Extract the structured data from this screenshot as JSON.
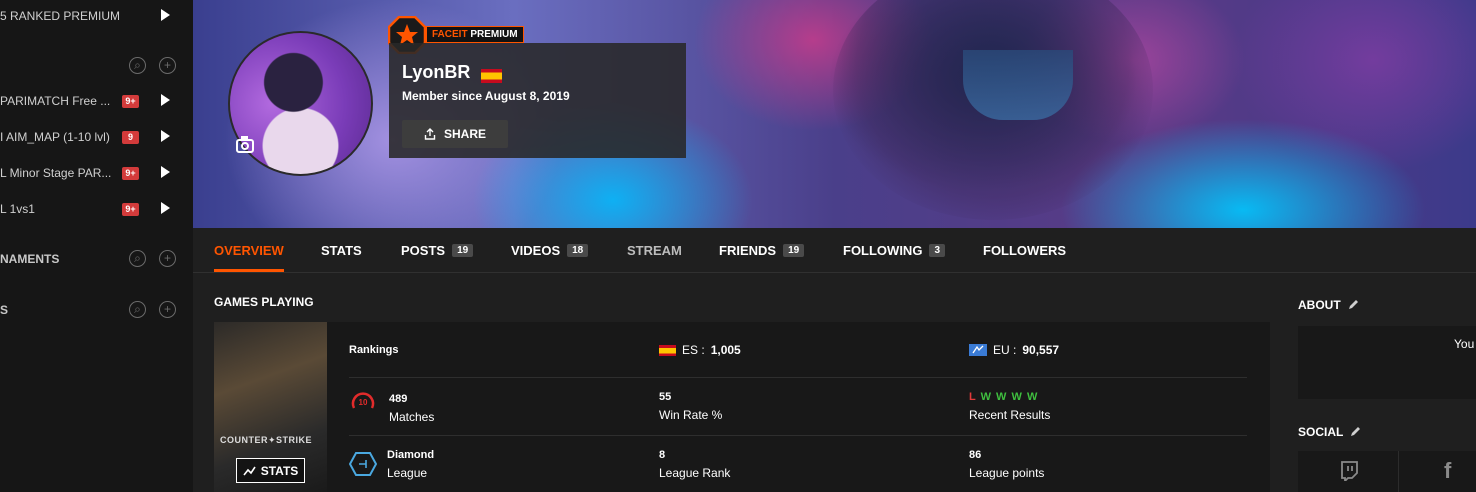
{
  "sidebar": {
    "rows": [
      {
        "label": "5 RANKED PREMIUM",
        "badge": "",
        "play": true
      },
      {
        "label": "PARIMATCH Free ...",
        "badge": "9+",
        "play": true
      },
      {
        "label": "I AIM_MAP (1-10 lvl)",
        "badge": "9",
        "play": true
      },
      {
        "label": "L Minor Stage PAR...",
        "badge": "9+",
        "play": true
      },
      {
        "label": "L 1vs1",
        "badge": "9+",
        "play": true
      }
    ],
    "headers": [
      {
        "label": ""
      },
      {
        "label": "NAMENTS"
      },
      {
        "label": "S"
      }
    ]
  },
  "profile": {
    "premium_label_a": "FACEIT",
    "premium_label_b": "PREMIUM",
    "nickname": "LyonBR",
    "member_since": "Member since August 8, 2019",
    "share_label": "SHARE"
  },
  "tabs": [
    {
      "label": "OVERVIEW",
      "count": ""
    },
    {
      "label": "STATS",
      "count": ""
    },
    {
      "label": "POSTS",
      "count": "19"
    },
    {
      "label": "VIDEOS",
      "count": "18"
    },
    {
      "label": "STREAM",
      "count": ""
    },
    {
      "label": "FRIENDS",
      "count": "19"
    },
    {
      "label": "FOLLOWING",
      "count": "3"
    },
    {
      "label": "FOLLOWERS",
      "count": ""
    }
  ],
  "games": {
    "title": "GAMES PLAYING",
    "cover_title": "COUNTER✦STRIKE",
    "stats_button": "STATS",
    "rankings_label": "Rankings",
    "ranking_es_label": "ES :",
    "ranking_es_value": "1,005",
    "ranking_eu_label": "EU :",
    "ranking_eu_value": "90,557",
    "level": "10",
    "matches_value": "489",
    "matches_label": "Matches",
    "winrate_value": "55",
    "winrate_label": "Win Rate %",
    "recent_results": [
      "L",
      "W",
      "W",
      "W",
      "W"
    ],
    "recent_label": "Recent Results",
    "league_value": "Diamond",
    "league_label": "League",
    "league_rank_value": "8",
    "league_rank_label": "League Rank",
    "league_points_value": "86",
    "league_points_label": "League points"
  },
  "right": {
    "about_title": "ABOUT",
    "about_text": "You",
    "social_title": "SOCIAL"
  },
  "colors": {
    "accent": "#ff5500",
    "badge": "#d33b3b",
    "win": "#3fbf3f",
    "loss": "#e23a3a"
  }
}
